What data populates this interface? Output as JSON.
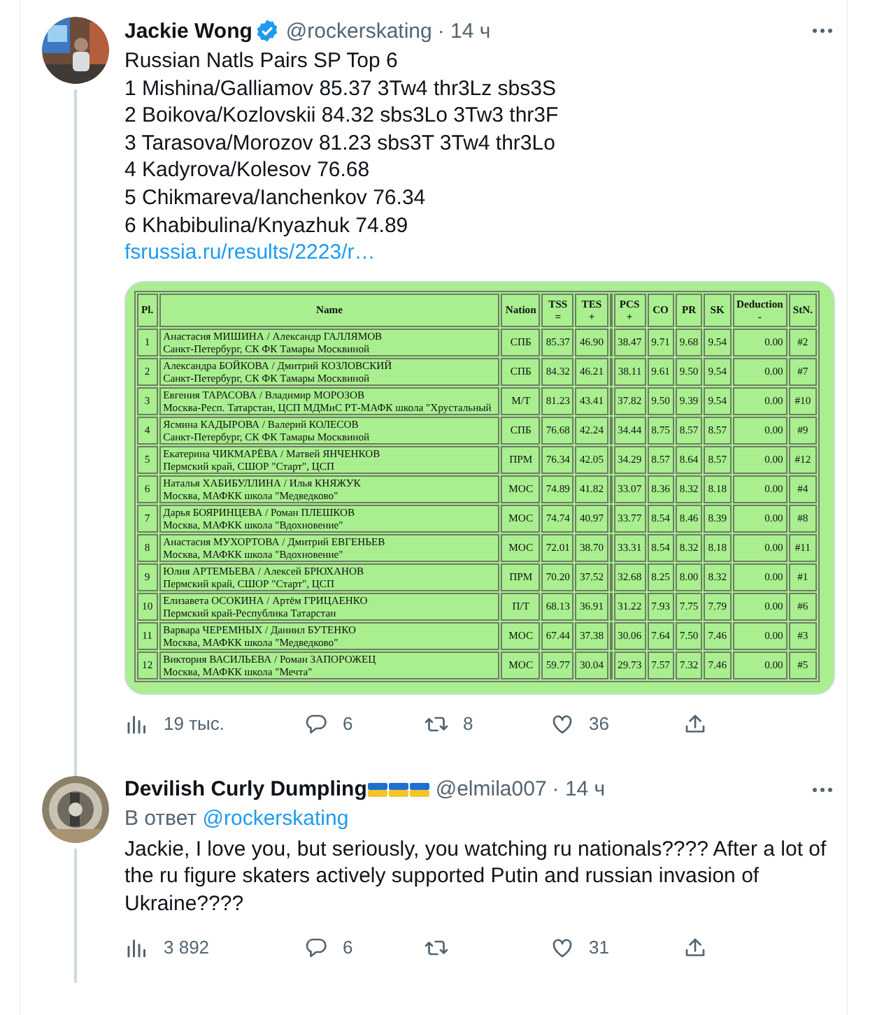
{
  "tweets": [
    {
      "author": {
        "name": "Jackie Wong",
        "verified": true,
        "handle": "@rockerskating",
        "time": "· 14 ч"
      },
      "connector_below": true,
      "text": "Russian Natls Pairs SP Top 6\n1 Mishina/Galliamov 85.37 3Tw4 thr3Lz sbs3S\n2 Boikova/Kozlovskii 84.32 sbs3Lo 3Tw3 thr3F\n3 Tarasova/Morozov 81.23 sbs3T 3Tw4 thr3Lo\n4 Kadyrova/Kolesov 76.68\n5 Chikmareva/Ianchenkov 76.34\n6 Khabibulina/Knyazhuk 74.89",
      "link": "fsrussia.ru/results/2223/r…",
      "results_table": {
        "columns": [
          {
            "label": "Pl."
          },
          {
            "label": "Name"
          },
          {
            "label": "Nation"
          },
          {
            "label": "TSS",
            "sign": "="
          },
          {
            "label": "TES",
            "sign": "+"
          },
          {
            "kind": "spacer"
          },
          {
            "label": "PCS",
            "sign": "+"
          },
          {
            "label": "CO"
          },
          {
            "label": "PR"
          },
          {
            "label": "SK"
          },
          {
            "label": "Deduction",
            "sign": "-"
          },
          {
            "label": "StN."
          }
        ],
        "rows": [
          {
            "pl": "1",
            "name": "Анастасия МИШИНА / Александр ГАЛЛЯМОВ",
            "club": "Санкт-Петербург, СК ФК Тамары Москвиной",
            "nation": "СПБ",
            "tss": "85.37",
            "tes": "46.90",
            "pcs": "38.47",
            "co": "9.71",
            "pr": "9.68",
            "sk": "9.54",
            "ded": "0.00",
            "stn": "#2"
          },
          {
            "pl": "2",
            "name": "Александра БОЙКОВА / Дмитрий КОЗЛОВСКИЙ",
            "club": "Санкт-Петербург, СК ФК Тамары Москвиной",
            "nation": "СПБ",
            "tss": "84.32",
            "tes": "46.21",
            "pcs": "38.11",
            "co": "9.61",
            "pr": "9.50",
            "sk": "9.54",
            "ded": "0.00",
            "stn": "#7"
          },
          {
            "pl": "3",
            "name": "Евгения ТАРАСОВА / Владимир МОРОЗОВ",
            "club": "Москва-Респ. Татарстан, ЦСП МДМиС РТ-МАФК школа \"Хрустальный",
            "nation": "М/Т",
            "tss": "81.23",
            "tes": "43.41",
            "pcs": "37.82",
            "co": "9.50",
            "pr": "9.39",
            "sk": "9.54",
            "ded": "0.00",
            "stn": "#10"
          },
          {
            "pl": "4",
            "name": "Ясмина КАДЫРОВА / Валерий КОЛЕСОВ",
            "club": "Санкт-Петербург, СК ФК Тамары Москвиной",
            "nation": "СПБ",
            "tss": "76.68",
            "tes": "42.24",
            "pcs": "34.44",
            "co": "8.75",
            "pr": "8.57",
            "sk": "8.57",
            "ded": "0.00",
            "stn": "#9"
          },
          {
            "pl": "5",
            "name": "Екатерина ЧИКМАРЁВА / Матвей ЯНЧЕНКОВ",
            "club": "Пермский край, СШОР \"Старт\", ЦСП",
            "nation": "ПРМ",
            "tss": "76.34",
            "tes": "42.05",
            "pcs": "34.29",
            "co": "8.57",
            "pr": "8.64",
            "sk": "8.57",
            "ded": "0.00",
            "stn": "#12"
          },
          {
            "pl": "6",
            "name": "Наталья ХАБИБУЛЛИНА / Илья КНЯЖУК",
            "club": "Москва, МАФКК школа \"Медведково\"",
            "nation": "МОС",
            "tss": "74.89",
            "tes": "41.82",
            "pcs": "33.07",
            "co": "8.36",
            "pr": "8.32",
            "sk": "8.18",
            "ded": "0.00",
            "stn": "#4"
          },
          {
            "pl": "7",
            "name": "Дарья БОЯРИНЦЕВА / Роман ПЛЕШКОВ",
            "club": "Москва, МАФКК школа \"Вдохновение\"",
            "nation": "МОС",
            "tss": "74.74",
            "tes": "40.97",
            "pcs": "33.77",
            "co": "8.54",
            "pr": "8.46",
            "sk": "8.39",
            "ded": "0.00",
            "stn": "#8"
          },
          {
            "pl": "8",
            "name": "Анастасия МУХОРТОВА / Дмитрий ЕВГЕНЬЕВ",
            "club": "Москва, МАФКК школа \"Вдохновение\"",
            "nation": "МОС",
            "tss": "72.01",
            "tes": "38.70",
            "pcs": "33.31",
            "co": "8.54",
            "pr": "8.32",
            "sk": "8.18",
            "ded": "0.00",
            "stn": "#11"
          },
          {
            "pl": "9",
            "name": "Юлия АРТЕМЬЕВА / Алексей БРЮХАНОВ",
            "club": "Пермский край, СШОР \"Старт\", ЦСП",
            "nation": "ПРМ",
            "tss": "70.20",
            "tes": "37.52",
            "pcs": "32.68",
            "co": "8.25",
            "pr": "8.00",
            "sk": "8.32",
            "ded": "0.00",
            "stn": "#1"
          },
          {
            "pl": "10",
            "name": "Елизавета ОСОКИНА / Артём ГРИЦАЕНКО",
            "club": "Пермский край-Республика Татарстан",
            "nation": "П/Т",
            "tss": "68.13",
            "tes": "36.91",
            "pcs": "31.22",
            "co": "7.93",
            "pr": "7.75",
            "sk": "7.79",
            "ded": "0.00",
            "stn": "#6"
          },
          {
            "pl": "11",
            "name": "Варвара ЧЕРЕМНЫХ / Даниил БУТЕНКО",
            "club": "Москва, МАФКК школа \"Медведково\"",
            "nation": "МОС",
            "tss": "67.44",
            "tes": "37.38",
            "pcs": "30.06",
            "co": "7.64",
            "pr": "7.50",
            "sk": "7.46",
            "ded": "0.00",
            "stn": "#3"
          },
          {
            "pl": "12",
            "name": "Виктория ВАСИЛЬЕВА / Роман ЗАПОРОЖЕЦ",
            "club": "Москва, МАФКК школа \"Мечта\"",
            "nation": "МОС",
            "tss": "59.77",
            "tes": "30.04",
            "pcs": "29.73",
            "co": "7.57",
            "pr": "7.32",
            "sk": "7.46",
            "ded": "0.00",
            "stn": "#5"
          }
        ]
      },
      "actions": [
        {
          "kind": "views",
          "count": "19 тыс."
        },
        {
          "kind": "reply",
          "count": "6"
        },
        {
          "kind": "retweet",
          "count": "8"
        },
        {
          "kind": "like",
          "count": "36"
        },
        {
          "kind": "share"
        }
      ]
    },
    {
      "author": {
        "name": "Devilish Curly Dumpling",
        "badges": [
          {
            "kind": "flag"
          },
          {
            "kind": "flag"
          },
          {
            "kind": "flag"
          }
        ],
        "handle": "@elmila007",
        "time": "· 14 ч"
      },
      "connector_above": true,
      "connector_below": true,
      "reply_to_label": "В ответ",
      "reply_to": "@rockerskating",
      "text": "Jackie, I love you, but seriously, you watching ru nationals???? After a lot of the ru figure skaters actively supported Putin and russian invasion of Ukraine????",
      "actions": [
        {
          "kind": "views",
          "count": "3 892"
        },
        {
          "kind": "reply",
          "count": "6"
        },
        {
          "kind": "retweet"
        },
        {
          "kind": "like",
          "count": "31"
        },
        {
          "kind": "share"
        }
      ]
    }
  ]
}
